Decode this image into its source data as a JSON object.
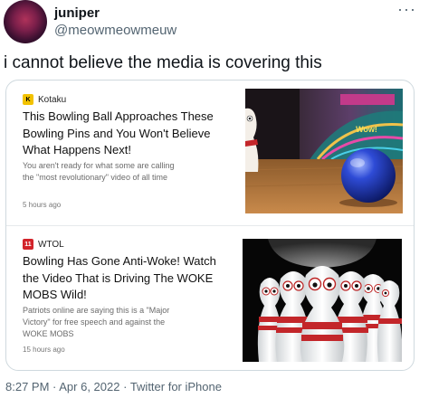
{
  "author": {
    "name": "juniper",
    "handle": "@meowmeowmeuw"
  },
  "more_icon": "more-horizontal-icon",
  "tweet_text": "i cannot believe the media is covering this",
  "articles": [
    {
      "source": "Kotaku",
      "source_logo_text": "K",
      "source_logo_color": "#f2c200",
      "headline": "This Bowling Ball Approaches These Bowling Pins and You Won't Believe What Happens Next!",
      "summary": "You aren't ready for what some are calling the \"most revolutionary\" video of all time",
      "age": "5 hours ago",
      "thumb_sign": "Wow!"
    },
    {
      "source": "WTOL",
      "source_logo_text": "11",
      "source_logo_color": "#d2232a",
      "headline": "Bowling Has Gone Anti-Woke! Watch the Video That is Driving The WOKE MOBS Wild!",
      "summary": "Patriots online are saying this is a \"Major Victory\" for free speech and against the WOKE MOBS",
      "age": "15 hours ago"
    }
  ],
  "footer": {
    "time": "8:27 PM",
    "sep1": " · ",
    "date": "Apr 6, 2022",
    "sep2": " · ",
    "client": "Twitter for iPhone"
  }
}
